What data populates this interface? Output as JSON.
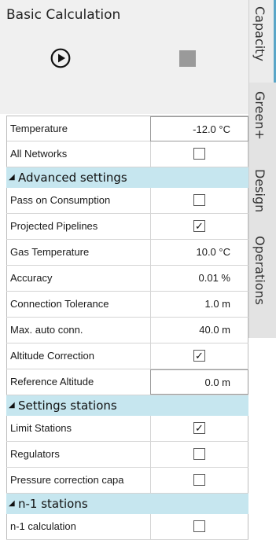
{
  "panel": {
    "title": "Basic Calculation"
  },
  "icons": {
    "play": "play-circle-icon",
    "stop": "stop-square-icon"
  },
  "grid": {
    "temperature": {
      "label": "Temperature",
      "value": "-12.0 °C"
    },
    "all_networks": {
      "label": "All Networks",
      "checked": false
    },
    "advanced": {
      "title": "Advanced settings",
      "rows": {
        "pass_on": {
          "label": "Pass on Consumption",
          "checked": false
        },
        "projected": {
          "label": "Projected Pipelines",
          "checked": true
        },
        "gas_temp": {
          "label": "Gas Temperature",
          "value": "10.0 °C"
        },
        "accuracy": {
          "label": "Accuracy",
          "value": "0.01 %"
        },
        "conn_tol": {
          "label": "Connection Tolerance",
          "value": "1.0 m"
        },
        "max_auto": {
          "label": "Max. auto conn.",
          "value": "40.0 m"
        },
        "alt_corr": {
          "label": "Altitude Correction",
          "checked": true
        },
        "ref_alt": {
          "label": "Reference Altitude",
          "value": "0.0 m"
        }
      }
    },
    "stations": {
      "title": "Settings stations",
      "rows": {
        "limit": {
          "label": "Limit Stations",
          "checked": true
        },
        "regulators": {
          "label": "Regulators",
          "checked": false
        },
        "pressure": {
          "label": "Pressure correction capa",
          "checked": false
        }
      }
    },
    "n1": {
      "title": "n-1 stations",
      "rows": {
        "calc": {
          "label": "n-1 calculation",
          "checked": false
        }
      }
    }
  },
  "tabs": {
    "capacity": "Capacity",
    "green": "Green+",
    "design": "Design",
    "operations": "Operations"
  },
  "colors": {
    "section_bg": "#c6e6ef",
    "tab_accent": "#5aa6c8",
    "stop": "#9a9a9a"
  }
}
